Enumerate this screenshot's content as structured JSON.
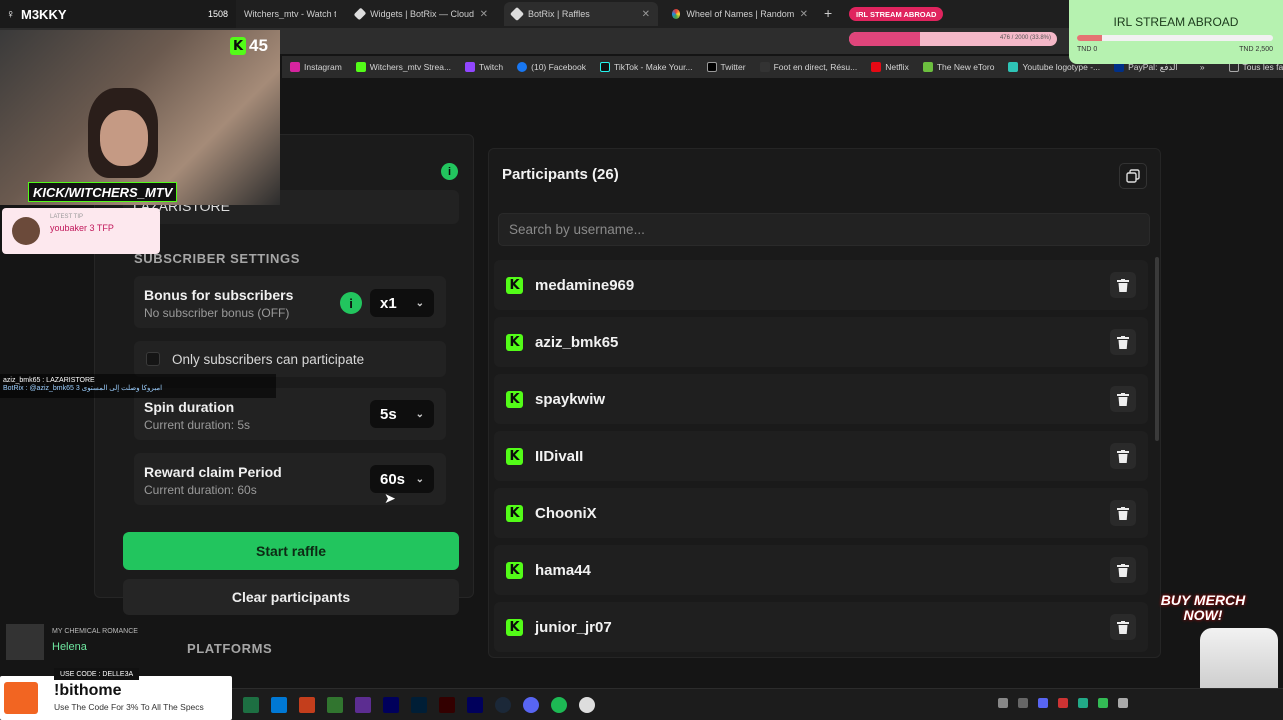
{
  "browser": {
    "tabs": [
      {
        "label": "Witchers_mtv - Watch the VOD",
        "active": false
      },
      {
        "label": "Widgets | BotRix — Cloud Strea",
        "active": false
      },
      {
        "label": "BotRix | Raffles",
        "active": true
      },
      {
        "label": "Wheel of Names | Random nam",
        "active": false
      }
    ],
    "new_tab": "+",
    "stream_badge": "IRL STREAM ABROAD",
    "bookmarks": [
      "Instagram",
      "Witchers_mtv Strea...",
      "Twitch",
      "(10) Facebook",
      "TikTok - Make Your...",
      "Twitter",
      "Foot en direct, Résu...",
      "Netflix",
      "The New eToro",
      "Youtube logotype -...",
      "PayPal: الدفع",
      "Tous les favoris"
    ],
    "progress_text": "476 / 2000 (33.8%)"
  },
  "stream_overlay": {
    "channel": "M3KKY",
    "viewers_top": "1508",
    "kick_count": "45",
    "kick_handle": "KICK/WITCHERS_MTV",
    "latest_tip_label": "LATEST TIP",
    "latest_tip": "youbaker 3 TFP",
    "goal_title": "IRL STREAM ABROAD",
    "goal_min": "TND 0",
    "goal_max": "TND 2,500",
    "goal_fraction": 0.13,
    "chat1": "aziz_bmk65 : LAZARISTORE",
    "chat2": "BotRix : @aziz_bmk65 امبروكا وصلت إلى المستوى 3",
    "music_label": "MY CHEMICAL ROMANCE",
    "music_track": "Helena",
    "merch": "BUY MERCH NOW!",
    "promo_code": "USE CODE : DELLE3A",
    "promo_title": "!bithome",
    "promo_sub": "Use The Code For 3% To All The Specs"
  },
  "settings": {
    "keyword_value": "LAZARISTORE",
    "subscriber_header": "SUBSCRIBER SETTINGS",
    "bonus_label": "Bonus for subscribers",
    "bonus_sub": "No subscriber bonus (OFF)",
    "bonus_value": "x1",
    "only_subs_label": "Only subscribers can participate",
    "only_subs_checked": false,
    "spin_label": "Spin duration",
    "spin_sub": "Current duration: 5s",
    "spin_value": "5s",
    "claim_label": "Reward claim Period",
    "claim_sub": "Current duration: 60s",
    "claim_value": "60s",
    "start_label": "Start raffle",
    "clear_label": "Clear participants",
    "platforms_header": "PLATFORMS"
  },
  "participants": {
    "title": "Participants (26)",
    "search_placeholder": "Search by username...",
    "items": [
      "medamine969",
      "aziz_bmk65",
      "spaykwiw",
      "IIDivaII",
      "ChooniX",
      "hama44",
      "junior_jr07"
    ]
  },
  "colors": {
    "accent": "#22c55e",
    "kick": "#53fc18"
  }
}
